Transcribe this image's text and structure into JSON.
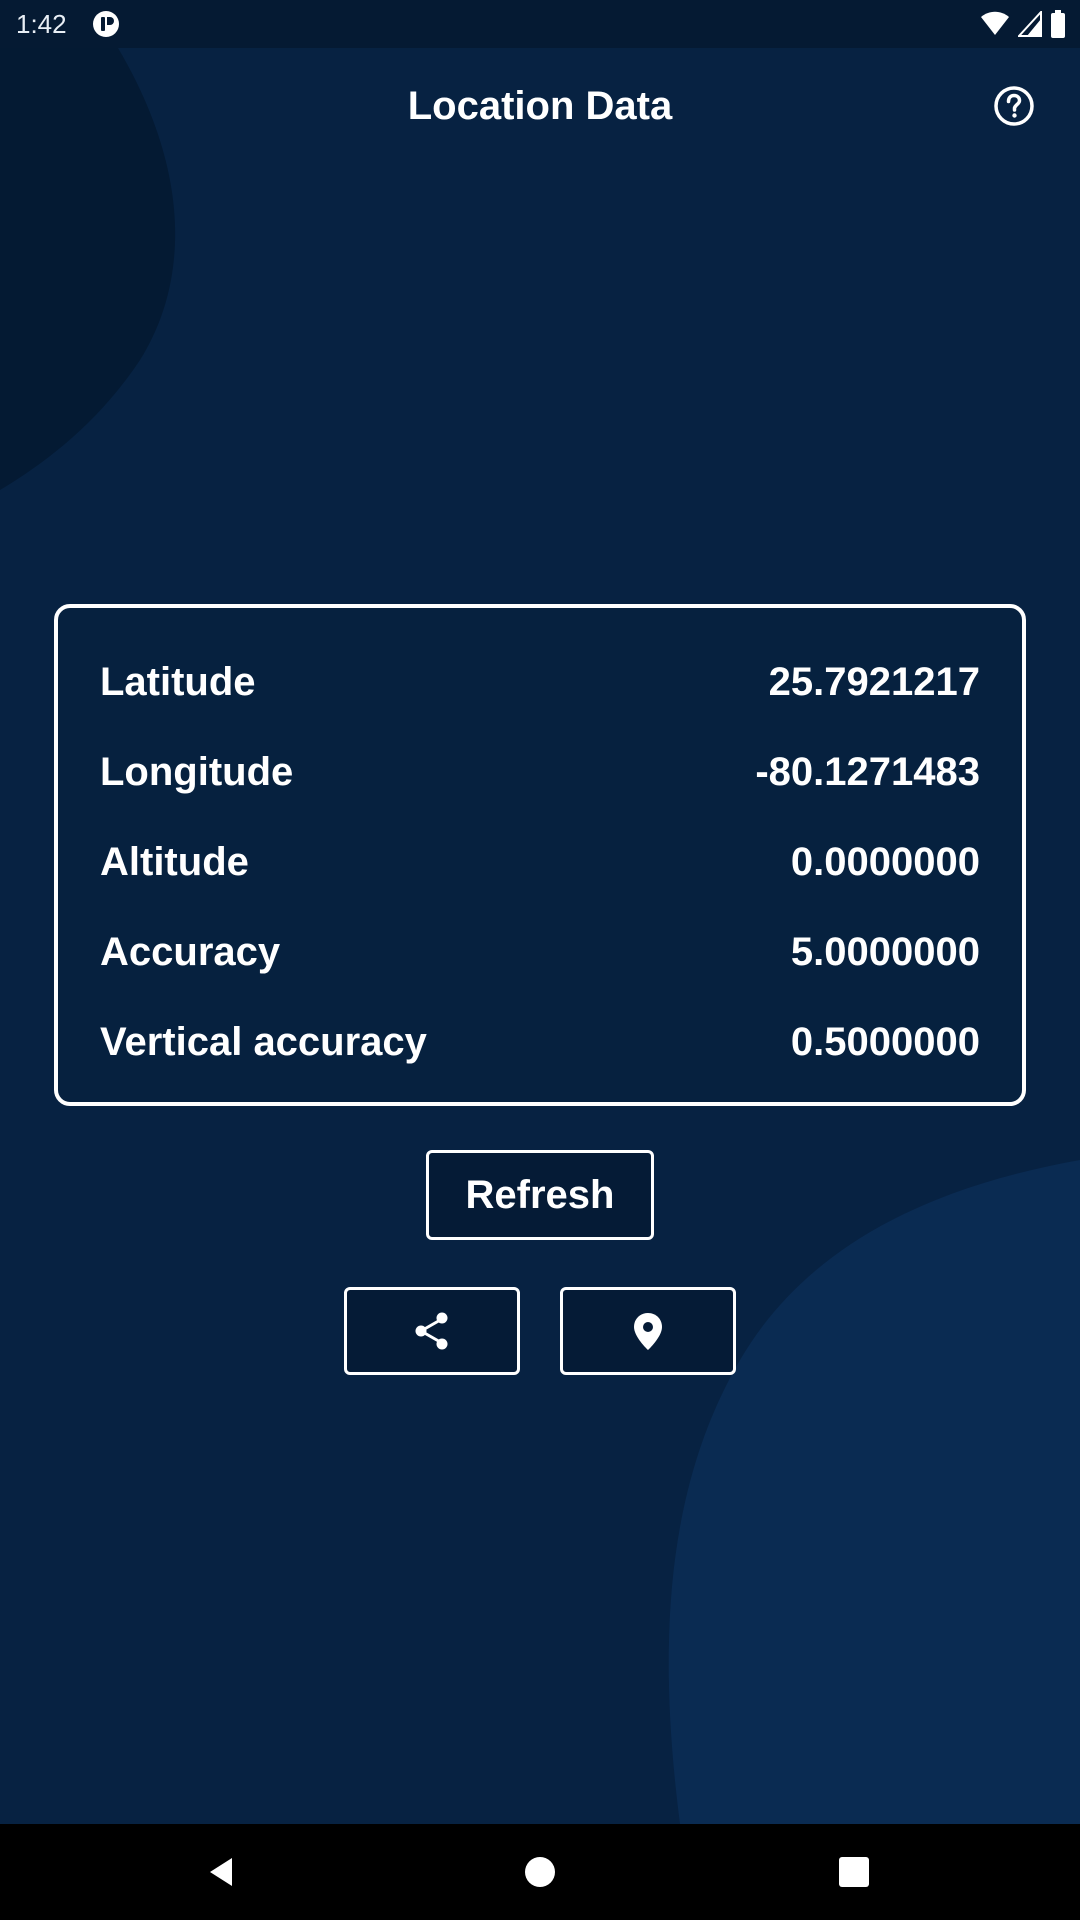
{
  "status_bar": {
    "time": "1:42",
    "icons": [
      "app-notification-icon",
      "wifi-icon",
      "cell-signal-icon",
      "battery-icon"
    ]
  },
  "header": {
    "title": "Location Data",
    "help_icon": "help-circle-icon"
  },
  "location": {
    "rows": [
      {
        "label": "Latitude",
        "value": "25.7921217"
      },
      {
        "label": "Longitude",
        "value": "-80.1271483"
      },
      {
        "label": "Altitude",
        "value": "0.0000000"
      },
      {
        "label": "Accuracy",
        "value": "5.0000000"
      },
      {
        "label": "Vertical accuracy",
        "value": "0.5000000"
      }
    ]
  },
  "actions": {
    "refresh_label": "Refresh",
    "share_icon": "share-icon",
    "location_icon": "map-pin-icon"
  },
  "nav": {
    "icons": [
      "back-icon",
      "home-icon",
      "recents-icon"
    ]
  },
  "colors": {
    "background": "#072242",
    "background_dark_blob": "#041A33",
    "background_light_blob": "#0A2B52",
    "status_bar": "#051A33",
    "card_fill": "#06213F",
    "button_fill": "#051B36",
    "foreground": "#FFFFFF",
    "nav_bar": "#000000"
  }
}
